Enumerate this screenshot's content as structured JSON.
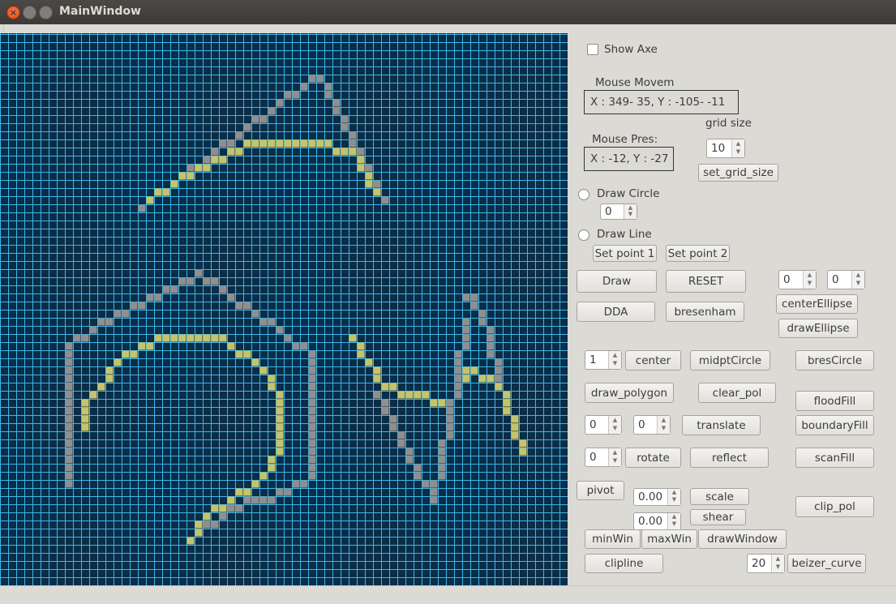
{
  "window": {
    "title": "MainWindow"
  },
  "canvas": {
    "grid_color": "#3fb5e8",
    "background": "#0a2e48",
    "cell_colors": {
      "gray": "#8f8f8f",
      "yellow": "#c5c46a"
    }
  },
  "panel": {
    "show_axes_label": "Show Axe",
    "mouse_move_label": "Mouse Movem",
    "mouse_move_value": "X : 349- 35, Y : -105- -11",
    "mouse_press_label": "Mouse Pres:",
    "mouse_press_value": "X : -12, Y : -27",
    "grid_size_label": "grid size",
    "grid_size_value": "10",
    "set_grid_size": "set_grid_size",
    "draw_circle_label": "Draw Circle",
    "circle_radius_value": "0",
    "draw_line_label": "Draw Line",
    "set_point1": "Set point 1",
    "set_point2": "Set point 2",
    "draw": "Draw",
    "reset": "RESET",
    "dda": "DDA",
    "bresenham": "bresenham",
    "ellipse_a": "0",
    "ellipse_b": "0",
    "center_ellipse": "centerEllipse",
    "draw_ellipse": "drawEllipse",
    "spin_center": "1",
    "center": "center",
    "midpt_circle": "midptCircle",
    "bres_circle": "bresCircle",
    "draw_polygon": "draw_polygon",
    "clear_pol": "clear_pol",
    "flood_fill": "floodFill",
    "tx": "0",
    "ty": "0",
    "translate": "translate",
    "boundary_fill": "boundaryFill",
    "angle": "0",
    "rotate": "rotate",
    "reflect": "reflect",
    "scan_fill": "scanFill",
    "pivot": "pivot",
    "sx": "0.00",
    "sy": "0.00",
    "scale": "scale",
    "shear": "shear",
    "clip_pol": "clip_pol",
    "min_win": "minWin",
    "max_win": "maxWin",
    "draw_window": "drawWindow",
    "clipline": "clipline",
    "bezier_n": "20",
    "bezier_curve": "beizer_curve"
  }
}
